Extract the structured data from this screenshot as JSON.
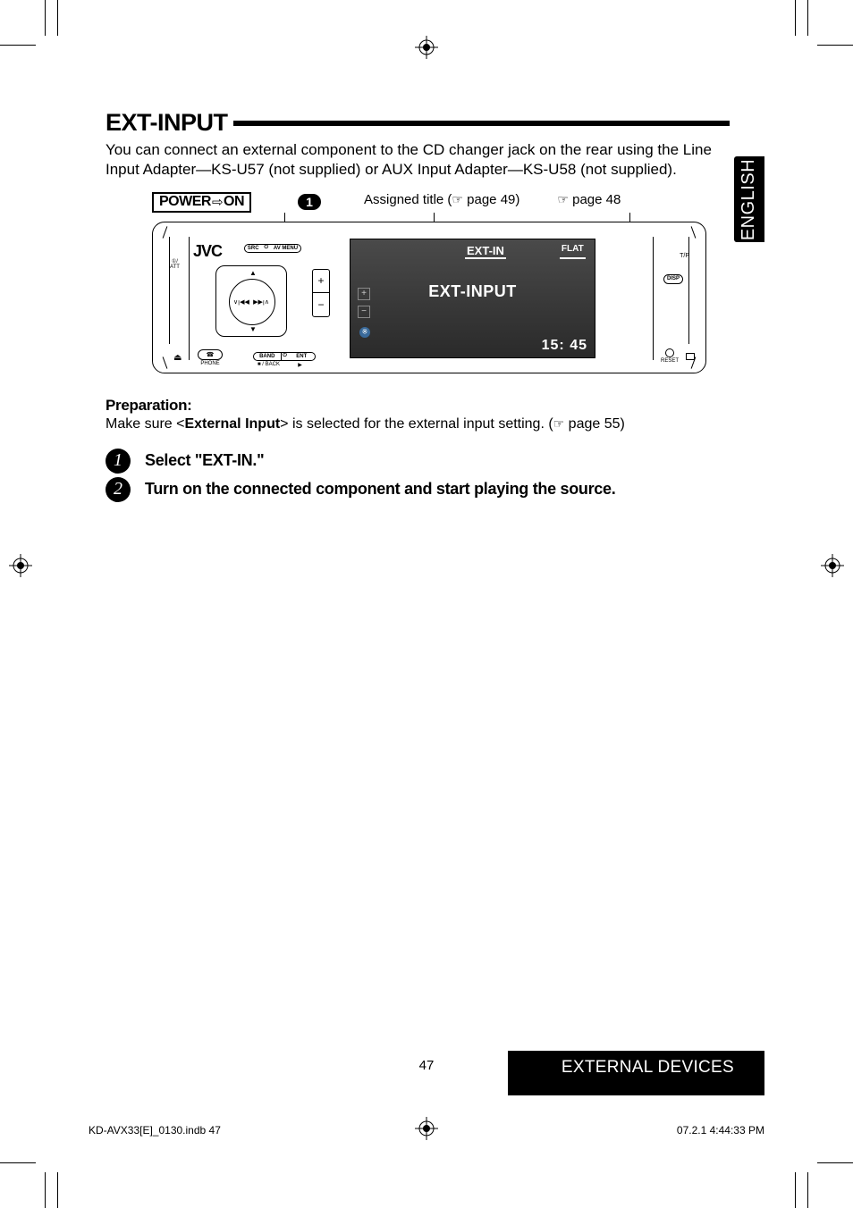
{
  "language_tab": "ENGLISH",
  "heading": "EXT-INPUT",
  "intro": "You can connect an external component to the CD changer jack on the rear using the Line Input Adapter—KS-U57 (not supplied) or AUX Input Adapter—KS-U58 (not supplied).",
  "diagram": {
    "power_label_pre": "POWER",
    "power_label_post": "ON",
    "callout_number": "1",
    "assigned_title_text": "Assigned title (",
    "assigned_title_page": " page 49)",
    "right_page_ref": " page 48",
    "device": {
      "brand": "JVC",
      "src_left": "SRC",
      "src_right": "AV MENU",
      "att_line1": "①/",
      "att_line2": "ATT",
      "band_left": "BAND",
      "band_right": "ENT",
      "band_sub_left": "■ / BACK",
      "band_sub_right": "▶",
      "phone_label": "PHONE",
      "tp_label": "T/P",
      "disp_label": "DISP",
      "reset_label": "RESET",
      "screen_top_label": "EXT-IN",
      "screen_eq_label": "FLAT",
      "screen_main": "EXT-INPUT",
      "screen_time": "15: 45"
    }
  },
  "preparation": {
    "heading": "Preparation:",
    "pre": "Make sure <",
    "bold": "External Input",
    "post": "> is selected for the external input setting. (",
    "page_ref": " page 55)"
  },
  "steps": [
    {
      "num": "1",
      "text": "Select \"EXT-IN.\""
    },
    {
      "num": "2",
      "text": "Turn on the connected component and start playing the source."
    }
  ],
  "page_number": "47",
  "footer_section": "EXTERNAL DEVICES",
  "footer_file": "KD-AVX33[E]_0130.indb   47",
  "footer_timestamp": "07.2.1   4:44:33 PM"
}
